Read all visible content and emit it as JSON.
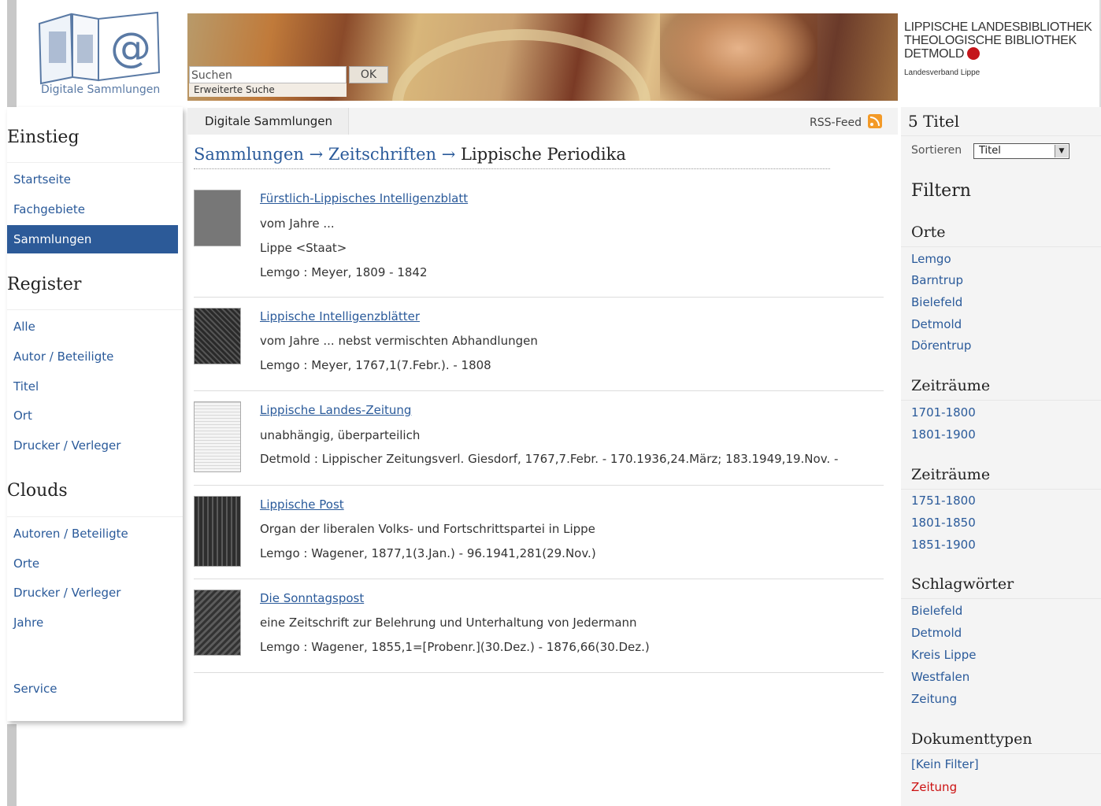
{
  "header": {
    "logo_caption": "Digitale Sammlungen",
    "search_placeholder": "Suchen",
    "search_button": "OK",
    "advanced_search": "Erweiterte Suche",
    "library_lines": [
      "LIPPISCHE LANDESBIBLIOTHEK",
      "THEOLOGISCHE BIBLIOTHEK",
      "DETMOLD"
    ],
    "library_sub": "Landesverband Lippe"
  },
  "leftnav": {
    "sections": [
      {
        "heading": "Einstieg",
        "items": [
          "Startseite",
          "Fachgebiete",
          "Sammlungen"
        ]
      },
      {
        "heading": "Register",
        "items": [
          "Alle",
          "Autor / Beteiligte",
          "Titel",
          "Ort",
          "Drucker / Verleger"
        ]
      },
      {
        "heading": "Clouds",
        "items": [
          "Autoren / Beteiligte",
          "Orte",
          "Drucker / Verleger",
          "Jahre"
        ]
      }
    ],
    "service": "Service",
    "active_item": "Sammlungen"
  },
  "topbar": {
    "tab": "Digitale Sammlungen",
    "rss": "RSS-Feed"
  },
  "breadcrumb": {
    "items": [
      "Sammlungen",
      "Zeitschriften"
    ],
    "separator": "→",
    "current": "Lippische Periodika"
  },
  "results": [
    {
      "title": "Fürstlich-Lippisches Intelligenzblatt",
      "lines": [
        "vom Jahre ...",
        "Lippe <Staat>",
        "Lemgo : Meyer, 1809 - 1842"
      ]
    },
    {
      "title": "Lippische Intelligenzblätter",
      "lines": [
        "vom Jahre ... nebst vermischten Abhandlungen",
        "Lemgo : Meyer, 1767,1(7.Febr.). - 1808"
      ]
    },
    {
      "title": "Lippische Landes-Zeitung",
      "lines": [
        "unabhängig, überparteilich",
        "Detmold : Lippischer Zeitungsverl. Giesdorf, 1767,7.Febr. - 170.1936,24.März; 183.1949,19.Nov. -"
      ]
    },
    {
      "title": "Lippische Post",
      "lines": [
        "Organ der liberalen Volks- und Fortschrittspartei in Lippe",
        "Lemgo : Wagener, 1877,1(3.Jan.) - 96.1941,281(29.Nov.)"
      ]
    },
    {
      "title": "Die Sonntagspost",
      "lines": [
        "eine Zeitschrift zur Belehrung und Unterhaltung von Jedermann",
        "Lemgo : Wagener, 1855,1=[Probenr.](30.Dez.) - 1876,66(30.Dez.)"
      ]
    }
  ],
  "rightpanel": {
    "count": "5 Titel",
    "sort_label": "Sortieren",
    "sort_value": "Titel",
    "filter_heading": "Filtern",
    "groups": [
      {
        "heading": "Orte",
        "links": [
          "Lemgo",
          "Barntrup",
          "Bielefeld",
          "Detmold",
          "Dörentrup"
        ]
      },
      {
        "heading": "Zeiträume",
        "links": [
          "1701-1800",
          "1801-1900"
        ]
      },
      {
        "heading": "Zeiträume",
        "links": [
          "1751-1800",
          "1801-1850",
          "1851-1900"
        ]
      },
      {
        "heading": "Schlagwörter",
        "links": [
          "Bielefeld",
          "Detmold",
          "Kreis Lippe",
          "Westfalen",
          "Zeitung"
        ]
      },
      {
        "heading": "Dokumenttypen",
        "links": [
          "[Kein Filter]",
          "Zeitung"
        ]
      }
    ],
    "active_filter_color": "#cc1111"
  }
}
